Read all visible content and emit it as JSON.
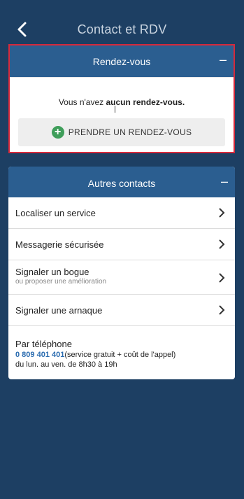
{
  "header": {
    "title": "Contact et RDV"
  },
  "rdv": {
    "title": "Rendez-vous",
    "collapse_symbol": "–",
    "message_prefix": "Vous n'avez ",
    "message_bold": "aucun rendez-vous.",
    "button_label": "PRENDRE UN RENDEZ-VOUS",
    "button_icon": "+"
  },
  "contacts": {
    "title": "Autres contacts",
    "collapse_symbol": "–",
    "items": [
      {
        "label": "Localiser un service"
      },
      {
        "label": "Messagerie sécurisée"
      },
      {
        "label": "Signaler un bogue",
        "sub": "ou proposer une amélioration"
      },
      {
        "label": "Signaler une arnaque"
      }
    ],
    "phone": {
      "title": "Par téléphone",
      "number": "0 809 401 401",
      "note": "(service gratuit + coût de l'appel)",
      "hours": "du lun. au ven. de 8h30 à 19h"
    }
  },
  "colors": {
    "background": "#1d3f63",
    "header_blue": "#2b5e90",
    "highlight_red": "#d6293b",
    "plus_green": "#3f9e5a",
    "phone_blue": "#2b6cb0"
  }
}
